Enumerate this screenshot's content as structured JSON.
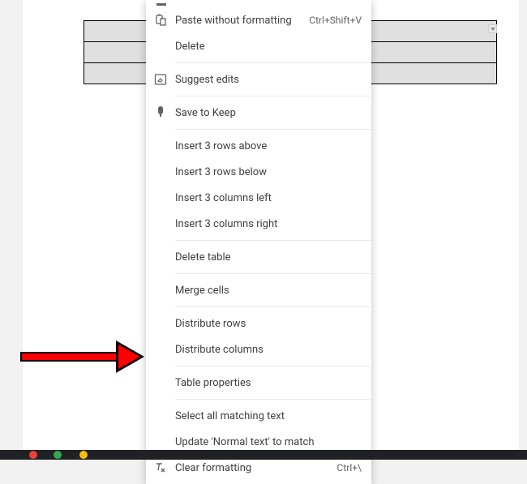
{
  "menu": {
    "paste_without_formatting": {
      "label": "Paste without formatting",
      "shortcut": "Ctrl+Shift+V"
    },
    "delete": {
      "label": "Delete"
    },
    "suggest_edits": {
      "label": "Suggest edits"
    },
    "save_to_keep": {
      "label": "Save to Keep"
    },
    "insert_rows_above": {
      "label": "Insert 3 rows above"
    },
    "insert_rows_below": {
      "label": "Insert 3 rows below"
    },
    "insert_cols_left": {
      "label": "Insert 3 columns left"
    },
    "insert_cols_right": {
      "label": "Insert 3 columns right"
    },
    "delete_table": {
      "label": "Delete table"
    },
    "merge_cells": {
      "label": "Merge cells"
    },
    "distribute_rows": {
      "label": "Distribute rows"
    },
    "distribute_columns": {
      "label": "Distribute columns"
    },
    "table_properties": {
      "label": "Table properties"
    },
    "select_matching": {
      "label": "Select all matching text"
    },
    "update_normal": {
      "label": "Update 'Normal text' to match"
    },
    "clear_formatting": {
      "label": "Clear formatting",
      "shortcut": "Ctrl+\\"
    }
  }
}
